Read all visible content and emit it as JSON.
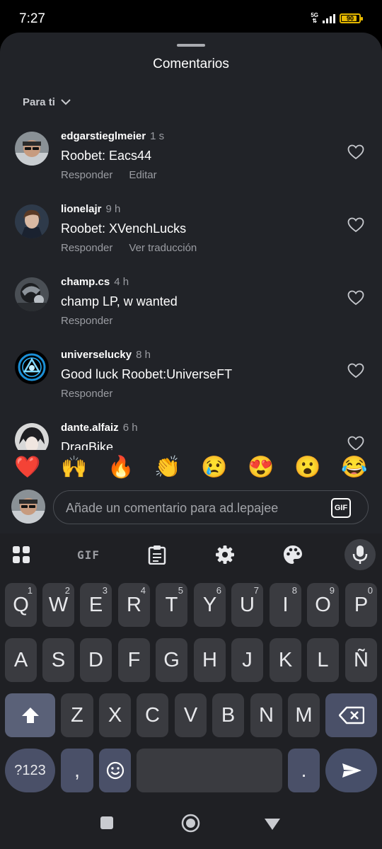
{
  "status": {
    "time": "7:27",
    "network": "5G",
    "battery": "90",
    "battery_level": 0.9,
    "accent": "#e6b800"
  },
  "sheet": {
    "title": "Comentarios",
    "filter_label": "Para ti",
    "filter_icon": "chevron-down-icon"
  },
  "comments": [
    {
      "username": "edgarstieglmeier",
      "time": "1 s",
      "text": "Roobet: Eacs44",
      "actions": [
        "Responder",
        "Editar"
      ]
    },
    {
      "username": "lionelajr",
      "time": "9 h",
      "text": "Roobet: XVenchLucks",
      "actions": [
        "Responder",
        "Ver traducción"
      ]
    },
    {
      "username": "champ.cs",
      "time": "4 h",
      "text": "champ LP, w wanted",
      "actions": [
        "Responder"
      ]
    },
    {
      "username": "universelucky",
      "time": "8 h",
      "text": "Good luck Roobet:UniverseFT",
      "actions": [
        "Responder"
      ]
    },
    {
      "username": "dante.alfaiz",
      "time": "6 h",
      "text": "DragBike",
      "actions": []
    }
  ],
  "emoji_reactions": [
    "❤️",
    "🙌",
    "🔥",
    "👏",
    "😢",
    "😍",
    "😮",
    "😂"
  ],
  "comment_input": {
    "placeholder": "Añade un comentario para ad.lepajee",
    "gif_label": "GIF"
  },
  "keyboard": {
    "toolbar": [
      "apps-grid-icon",
      "GIF",
      "clipboard-icon",
      "settings-gear-icon",
      "palette-icon",
      "mic-icon"
    ],
    "gif_label": "GIF",
    "row1": [
      {
        "key": "Q",
        "hint": "1"
      },
      {
        "key": "W",
        "hint": "2"
      },
      {
        "key": "E",
        "hint": "3"
      },
      {
        "key": "R",
        "hint": "4"
      },
      {
        "key": "T",
        "hint": "5"
      },
      {
        "key": "Y",
        "hint": "6"
      },
      {
        "key": "U",
        "hint": "7"
      },
      {
        "key": "I",
        "hint": "8"
      },
      {
        "key": "O",
        "hint": "9"
      },
      {
        "key": "P",
        "hint": "0"
      }
    ],
    "row2": [
      "A",
      "S",
      "D",
      "F",
      "G",
      "H",
      "J",
      "K",
      "L",
      "Ñ"
    ],
    "row3": [
      "Z",
      "X",
      "C",
      "V",
      "B",
      "N",
      "M"
    ],
    "bottom": {
      "symbols": "?123",
      "comma": ",",
      "period": "."
    }
  },
  "nav": [
    "recents-square-icon",
    "home-circle-icon",
    "back-triangle-icon"
  ]
}
